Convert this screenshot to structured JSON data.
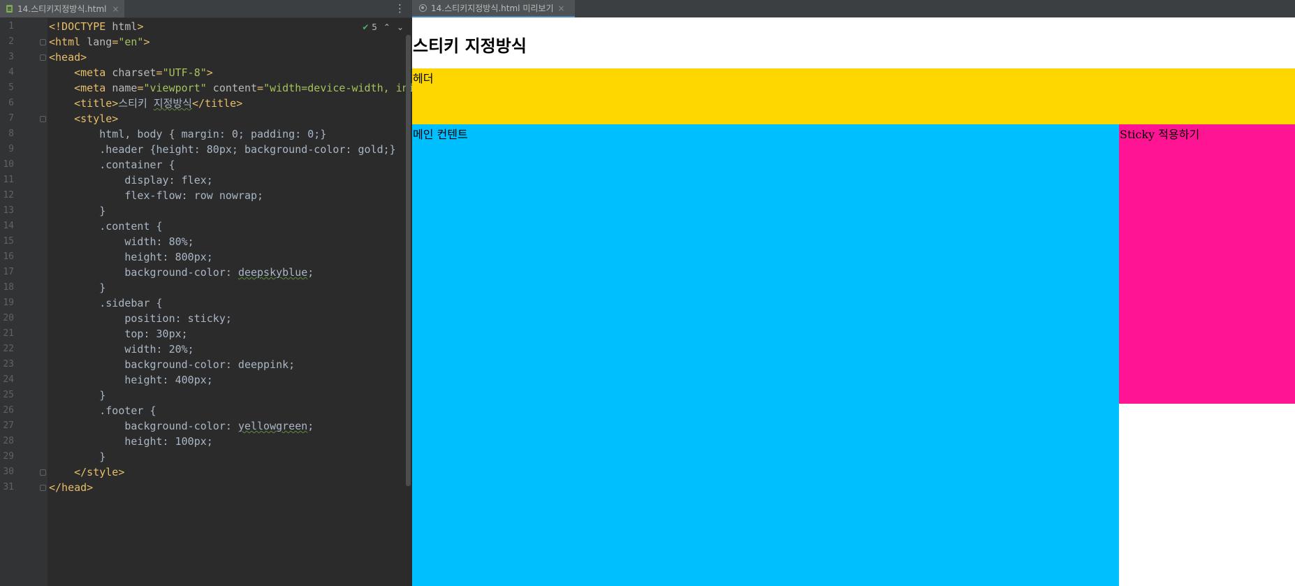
{
  "editor": {
    "tab_label": "14.스티키지정방식.html",
    "tab_close": "×",
    "menu_glyph": "⋮",
    "inspection_count": "5",
    "lines": [
      {
        "n": "1",
        "parts": [
          [
            "k",
            "<!DOCTYPE "
          ],
          [
            "a",
            "html"
          ],
          [
            "k",
            ">"
          ]
        ]
      },
      {
        "n": "2",
        "parts": [
          [
            "k",
            "<html "
          ],
          [
            "a",
            "lang"
          ],
          [
            "k",
            "="
          ],
          [
            "s",
            "\"en\""
          ],
          [
            "k",
            ">"
          ]
        ]
      },
      {
        "n": "3",
        "parts": [
          [
            "k",
            "<head>"
          ]
        ]
      },
      {
        "n": "4",
        "parts": [
          [
            "t",
            "    "
          ],
          [
            "k",
            "<meta "
          ],
          [
            "a",
            "charset"
          ],
          [
            "k",
            "="
          ],
          [
            "s",
            "\"UTF-8\""
          ],
          [
            "k",
            ">"
          ]
        ]
      },
      {
        "n": "5",
        "parts": [
          [
            "t",
            "    "
          ],
          [
            "k",
            "<meta "
          ],
          [
            "a",
            "name"
          ],
          [
            "k",
            "="
          ],
          [
            "s",
            "\"viewport\""
          ],
          [
            "a",
            " content"
          ],
          [
            "k",
            "="
          ],
          [
            "s",
            "\"width=device-width, ini"
          ]
        ]
      },
      {
        "n": "6",
        "parts": [
          [
            "t",
            "    "
          ],
          [
            "k",
            "<title>"
          ],
          [
            "t",
            "스티키 "
          ],
          [
            "tu",
            "지정방식"
          ],
          [
            "k",
            "</title>"
          ]
        ]
      },
      {
        "n": "7",
        "parts": [
          [
            "t",
            "    "
          ],
          [
            "k",
            "<style>"
          ]
        ]
      },
      {
        "n": "8",
        "parts": [
          [
            "t",
            "        html, body { margin: 0; padding: 0;}"
          ]
        ]
      },
      {
        "n": "9",
        "parts": [
          [
            "t",
            "        .header {height: 80px; background-color: gold;}"
          ]
        ]
      },
      {
        "n": "10",
        "parts": [
          [
            "t",
            "        .container {"
          ]
        ]
      },
      {
        "n": "11",
        "parts": [
          [
            "t",
            "            display: flex;"
          ]
        ]
      },
      {
        "n": "12",
        "parts": [
          [
            "t",
            "            flex-flow: row nowrap;"
          ]
        ]
      },
      {
        "n": "13",
        "parts": [
          [
            "t",
            "        }"
          ]
        ]
      },
      {
        "n": "14",
        "parts": [
          [
            "t",
            "        .content {"
          ]
        ]
      },
      {
        "n": "15",
        "parts": [
          [
            "t",
            "            width: 80%;"
          ]
        ]
      },
      {
        "n": "16",
        "parts": [
          [
            "t",
            "            height: 800px;"
          ]
        ]
      },
      {
        "n": "17",
        "parts": [
          [
            "t",
            "            background-color: "
          ],
          [
            "tu",
            "deepskyblue"
          ],
          [
            "t",
            ";"
          ]
        ]
      },
      {
        "n": "18",
        "parts": [
          [
            "t",
            "        }"
          ]
        ]
      },
      {
        "n": "19",
        "parts": [
          [
            "t",
            "        .sidebar {"
          ]
        ]
      },
      {
        "n": "20",
        "parts": [
          [
            "t",
            "            position: sticky;"
          ]
        ]
      },
      {
        "n": "21",
        "parts": [
          [
            "t",
            "            top: 30px;"
          ]
        ]
      },
      {
        "n": "22",
        "parts": [
          [
            "t",
            "            width: 20%;"
          ]
        ]
      },
      {
        "n": "23",
        "parts": [
          [
            "t",
            "            background-color: deeppink;"
          ]
        ]
      },
      {
        "n": "24",
        "parts": [
          [
            "t",
            "            height: 400px;"
          ]
        ]
      },
      {
        "n": "25",
        "parts": [
          [
            "t",
            "        }"
          ]
        ]
      },
      {
        "n": "26",
        "parts": [
          [
            "t",
            "        .footer {"
          ]
        ]
      },
      {
        "n": "27",
        "parts": [
          [
            "t",
            "            background-color: "
          ],
          [
            "tu",
            "yellowgreen"
          ],
          [
            "t",
            ";"
          ]
        ]
      },
      {
        "n": "28",
        "parts": [
          [
            "t",
            "            height: 100px;"
          ]
        ]
      },
      {
        "n": "29",
        "parts": [
          [
            "t",
            "        }"
          ]
        ]
      },
      {
        "n": "30",
        "parts": [
          [
            "t",
            "    "
          ],
          [
            "k",
            "</style>"
          ]
        ]
      },
      {
        "n": "31",
        "parts": [
          [
            "k",
            "</head>"
          ]
        ]
      }
    ],
    "fold_lines": [
      "2",
      "3",
      "7",
      "30",
      "31"
    ]
  },
  "preview": {
    "tab_label": "14.스티키지정방식.html 미리보기",
    "tab_close": "×",
    "page": {
      "title": "스티키 지정방식",
      "header_text": "헤더",
      "content_text": "메인 컨텐트",
      "sidebar_text": "Sticky 적용하기"
    }
  },
  "colors": {
    "header": "gold",
    "content": "deepskyblue",
    "sidebar": "deeppink",
    "tag": "#e8bf6a",
    "string": "#a5c25c",
    "attribute": "#bababa",
    "text": "#a9b7c6"
  }
}
